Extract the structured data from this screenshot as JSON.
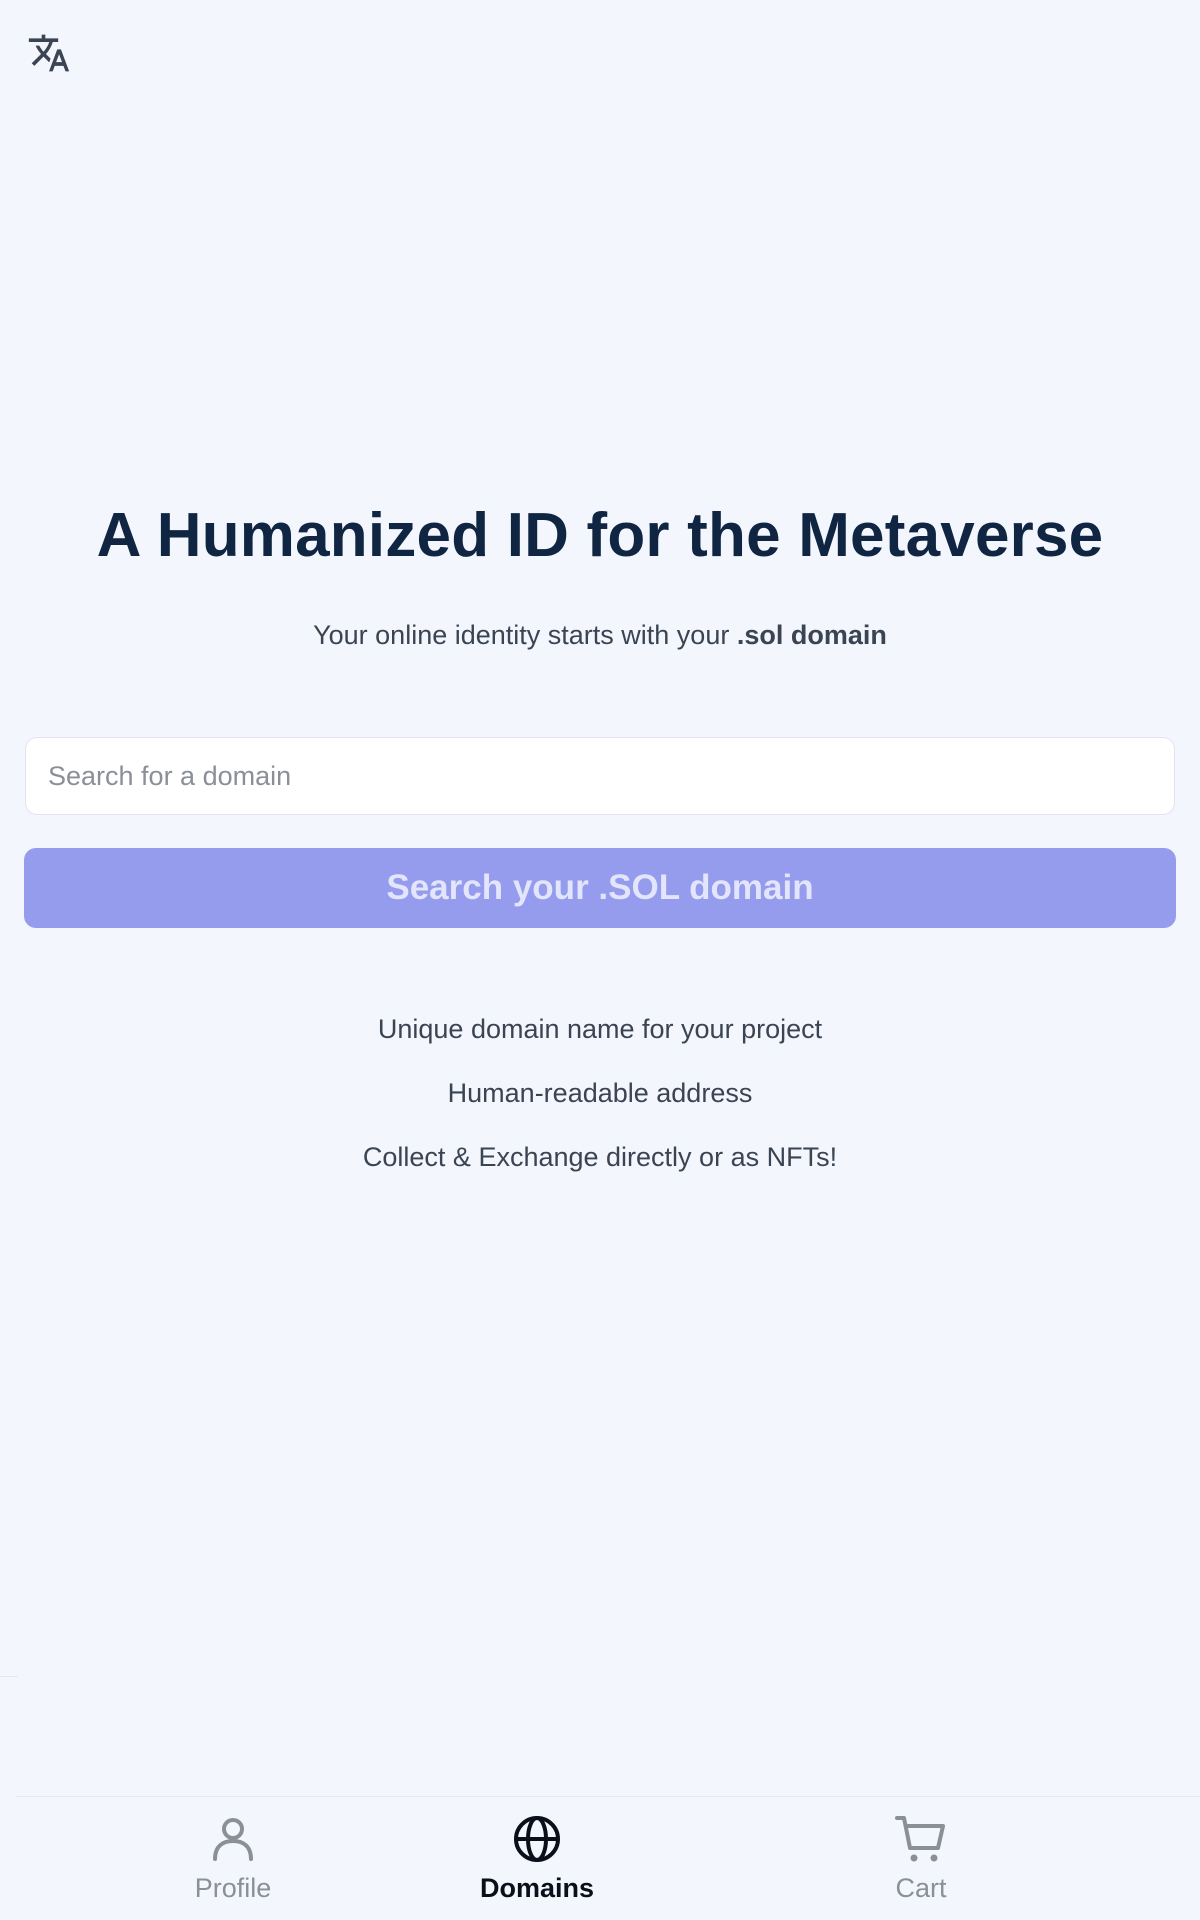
{
  "hero": {
    "title": "A Humanized ID for the Metaverse",
    "subtitle_prefix": "Your online identity starts with your ",
    "subtitle_strong": ".sol domain"
  },
  "search": {
    "placeholder": "Search for a domain",
    "button_label": "Search your .SOL domain"
  },
  "features": [
    "Unique domain name for your project",
    "Human-readable address",
    "Collect & Exchange directly or as NFTs!"
  ],
  "bottom_nav": {
    "items": [
      {
        "label": "Profile",
        "icon": "person-icon",
        "active": false
      },
      {
        "label": "Domains",
        "icon": "globe-icon",
        "active": true
      },
      {
        "label": "Cart",
        "icon": "cart-icon",
        "active": false
      }
    ]
  },
  "colors": {
    "background": "#f3f6fd",
    "title": "#0f2542",
    "button_bg": "#969ced",
    "button_text": "#e2e5fb",
    "nav_inactive": "#8a8f98",
    "nav_active": "#0b0f1a"
  }
}
